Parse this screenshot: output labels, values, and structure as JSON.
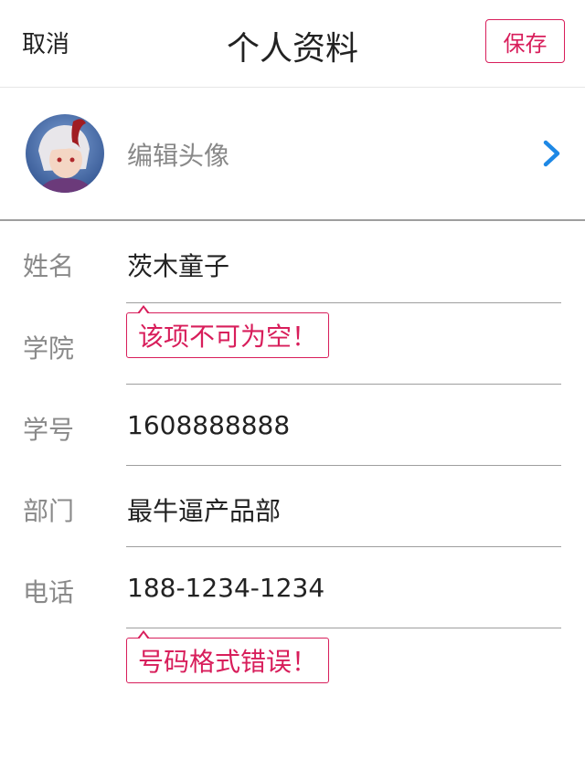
{
  "header": {
    "cancel_label": "取消",
    "title": "个人资料",
    "save_label": "保存"
  },
  "avatar_row": {
    "label": "编辑头像",
    "chevron_icon": "chevron-right-icon"
  },
  "fields": [
    {
      "label": "姓名",
      "value": "茨木童子",
      "error": ""
    },
    {
      "label": "学院",
      "value": "",
      "error": "该项不可为空！"
    },
    {
      "label": "学号",
      "value": "1608888888",
      "error": ""
    },
    {
      "label": "部门",
      "value": "最牛逼产品部",
      "error": ""
    },
    {
      "label": "电话",
      "value": "188-1234-1234",
      "error": "号码格式错误！"
    }
  ],
  "colors": {
    "accent": "#d81e5b",
    "chevron": "#1e88e5",
    "label": "#8a8a8a",
    "text": "#222222"
  }
}
